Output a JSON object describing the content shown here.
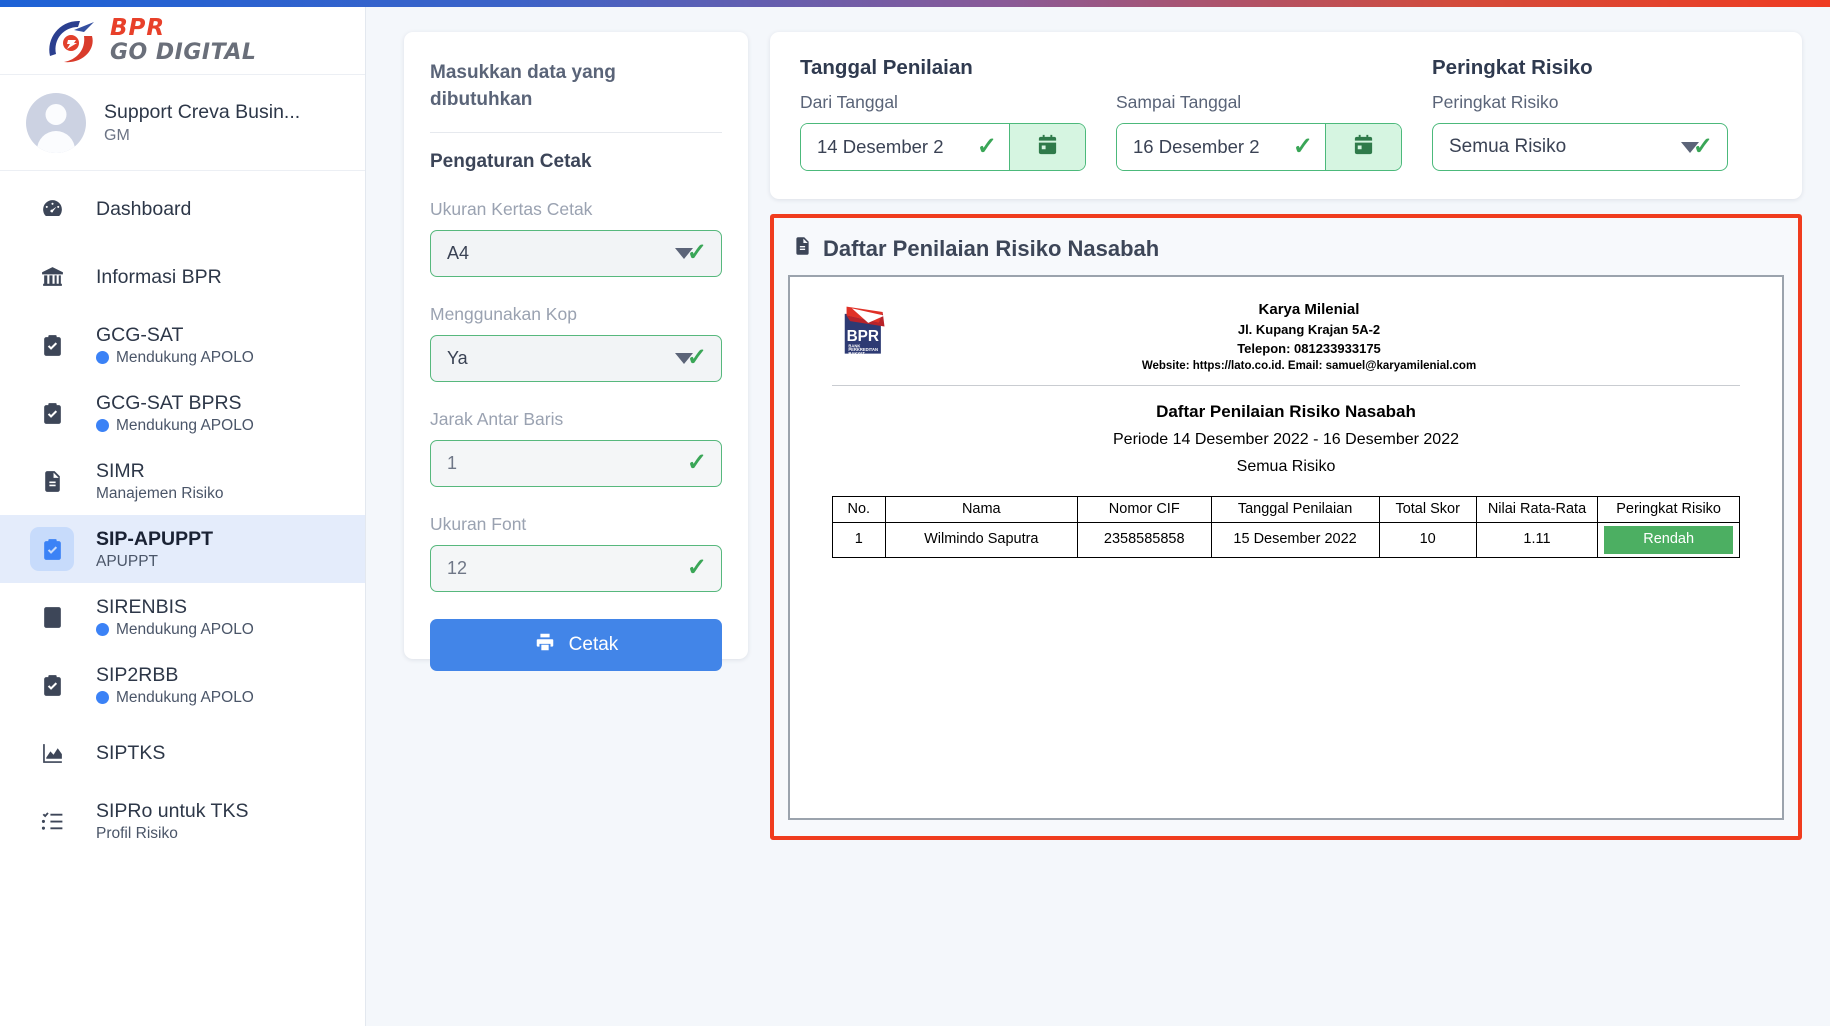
{
  "brand": {
    "line1": "BPR",
    "line2": "GO DIGITAL"
  },
  "profile": {
    "name": "Support Creva Busin...",
    "role": "GM"
  },
  "sidebar": {
    "items": [
      {
        "label": "Dashboard",
        "sub": "",
        "icon": "dashboard-icon",
        "dot": false,
        "active": false
      },
      {
        "label": "Informasi BPR",
        "sub": "",
        "icon": "bank-icon",
        "dot": false,
        "active": false
      },
      {
        "label": "GCG-SAT",
        "sub": "Mendukung APOLO",
        "icon": "clipboard-check-icon",
        "dot": true,
        "active": false
      },
      {
        "label": "GCG-SAT BPRS",
        "sub": "Mendukung APOLO",
        "icon": "clipboard-check-icon",
        "dot": true,
        "active": false
      },
      {
        "label": "SIMR",
        "sub": "Manajemen Risiko",
        "icon": "document-icon",
        "dot": false,
        "active": false
      },
      {
        "label": "SIP-APUPPT",
        "sub": "APUPPT",
        "icon": "clipboard-check-icon",
        "dot": false,
        "active": true
      },
      {
        "label": "SIRENBIS",
        "sub": "Mendukung APOLO",
        "icon": "book-icon",
        "dot": true,
        "active": false
      },
      {
        "label": "SIP2RBB",
        "sub": "Mendukung APOLO",
        "icon": "clipboard-check-icon",
        "dot": true,
        "active": false
      },
      {
        "label": "SIPTKS",
        "sub": "",
        "icon": "chart-area-icon",
        "dot": false,
        "active": false
      },
      {
        "label": "SIPRo untuk TKS",
        "sub": "Profil Risiko",
        "icon": "checklist-icon",
        "dot": false,
        "active": false
      }
    ]
  },
  "print_panel": {
    "card_title": "Masukkan data yang dibutuhkan",
    "section_title": "Pengaturan Cetak",
    "paper_size_label": "Ukuran Kertas Cetak",
    "paper_size_value": "A4",
    "kop_label": "Menggunakan Kop",
    "kop_value": "Ya",
    "line_spacing_label": "Jarak Antar Baris",
    "line_spacing_value": "1",
    "font_size_label": "Ukuran Font",
    "font_size_value": "12",
    "print_button": "Cetak"
  },
  "filters": {
    "date_group_title": "Tanggal Penilaian",
    "from_label": "Dari Tanggal",
    "from_value": "14 Desember 2",
    "to_label": "Sampai Tanggal",
    "to_value": "16 Desember 2",
    "risk_group_title": "Peringkat Risiko",
    "risk_label": "Peringkat Risiko",
    "risk_value": "Semua Risiko"
  },
  "preview": {
    "header_title": "Daftar Penilaian Risiko Nasabah",
    "letterhead": {
      "logo_text": "BPR",
      "logo_sub": "BANK PERKREDITAN RAKYAT",
      "company": "Karya Milenial",
      "address": "Jl. Kupang Krajan 5A-2",
      "phone": "Telepon: 081233933175",
      "web": "Website: https://lato.co.id. Email: samuel@karyamilenial.com"
    },
    "doc_title": "Daftar Penilaian Risiko Nasabah",
    "doc_period": "Periode 14 Desember 2022 - 16 Desember 2022",
    "doc_risk": "Semua Risiko",
    "table": {
      "headers": [
        "No.",
        "Nama",
        "Nomor CIF",
        "Tanggal Penilaian",
        "Total Skor",
        "Nilai Rata-Rata",
        "Peringkat Risiko"
      ],
      "rows": [
        {
          "no": "1",
          "nama": "Wilmindo Saputra",
          "cif": "2358585858",
          "tanggal": "15 Desember 2022",
          "total_skor": "10",
          "rata_rata": "1.11",
          "peringkat": "Rendah"
        }
      ]
    }
  },
  "colors": {
    "accent_blue": "#4285e8",
    "border_green": "#4cb97b",
    "risk_low_green": "#4caf62",
    "highlight_red": "#f03c1e",
    "active_nav": "#e4ecfb"
  }
}
